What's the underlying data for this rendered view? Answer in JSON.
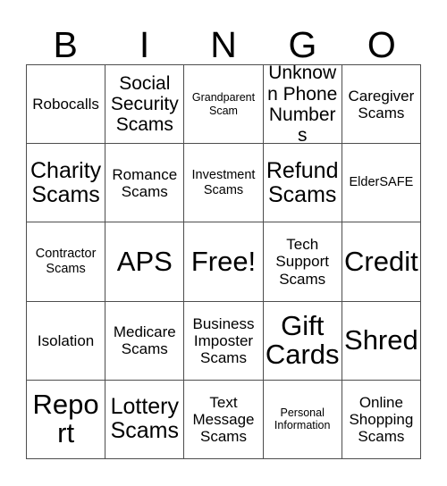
{
  "card": {
    "title": "BINGO Card",
    "header_letters": [
      "B",
      "I",
      "N",
      "G",
      "O"
    ],
    "grid_size": 5,
    "colors": {
      "border": "#4d4d4d",
      "background": "#ffffff",
      "text": "#000000"
    },
    "cells": [
      {
        "label": "Robocalls",
        "size": "m",
        "row": 1,
        "col": 1
      },
      {
        "label": "Social Security Scams",
        "size": "l",
        "row": 1,
        "col": 2
      },
      {
        "label": "Grandparent Scam",
        "size": "xs",
        "row": 1,
        "col": 3
      },
      {
        "label": "Unknown Phone Numbers",
        "size": "l",
        "row": 1,
        "col": 4
      },
      {
        "label": "Caregiver Scams",
        "size": "m",
        "row": 1,
        "col": 5
      },
      {
        "label": "Charity Scams",
        "size": "xl",
        "row": 2,
        "col": 1
      },
      {
        "label": "Romance Scams",
        "size": "m",
        "row": 2,
        "col": 2
      },
      {
        "label": "Investment Scams",
        "size": "s",
        "row": 2,
        "col": 3
      },
      {
        "label": "Refund Scams",
        "size": "xl",
        "row": 2,
        "col": 4
      },
      {
        "label": "ElderSAFE",
        "size": "s",
        "row": 2,
        "col": 5
      },
      {
        "label": "Contractor Scams",
        "size": "s",
        "row": 3,
        "col": 1
      },
      {
        "label": "APS",
        "size": "xxl",
        "row": 3,
        "col": 2
      },
      {
        "label": "Free!",
        "size": "xxl",
        "row": 3,
        "col": 3
      },
      {
        "label": "Tech Support Scams",
        "size": "m",
        "row": 3,
        "col": 4
      },
      {
        "label": "Credit",
        "size": "xxl",
        "row": 3,
        "col": 5
      },
      {
        "label": "Isolation",
        "size": "m",
        "row": 4,
        "col": 1
      },
      {
        "label": "Medicare Scams",
        "size": "m",
        "row": 4,
        "col": 2
      },
      {
        "label": "Business Imposter Scams",
        "size": "m",
        "row": 4,
        "col": 3
      },
      {
        "label": "Gift Cards",
        "size": "xxl",
        "row": 4,
        "col": 4
      },
      {
        "label": "Shred",
        "size": "xxl",
        "row": 4,
        "col": 5
      },
      {
        "label": "Report",
        "size": "xxl",
        "row": 5,
        "col": 1
      },
      {
        "label": "Lottery Scams",
        "size": "xl",
        "row": 5,
        "col": 2
      },
      {
        "label": "Text Message Scams",
        "size": "m",
        "row": 5,
        "col": 3
      },
      {
        "label": "Personal Information",
        "size": "xs",
        "row": 5,
        "col": 4
      },
      {
        "label": "Online Shopping Scams",
        "size": "m",
        "row": 5,
        "col": 5
      }
    ]
  }
}
